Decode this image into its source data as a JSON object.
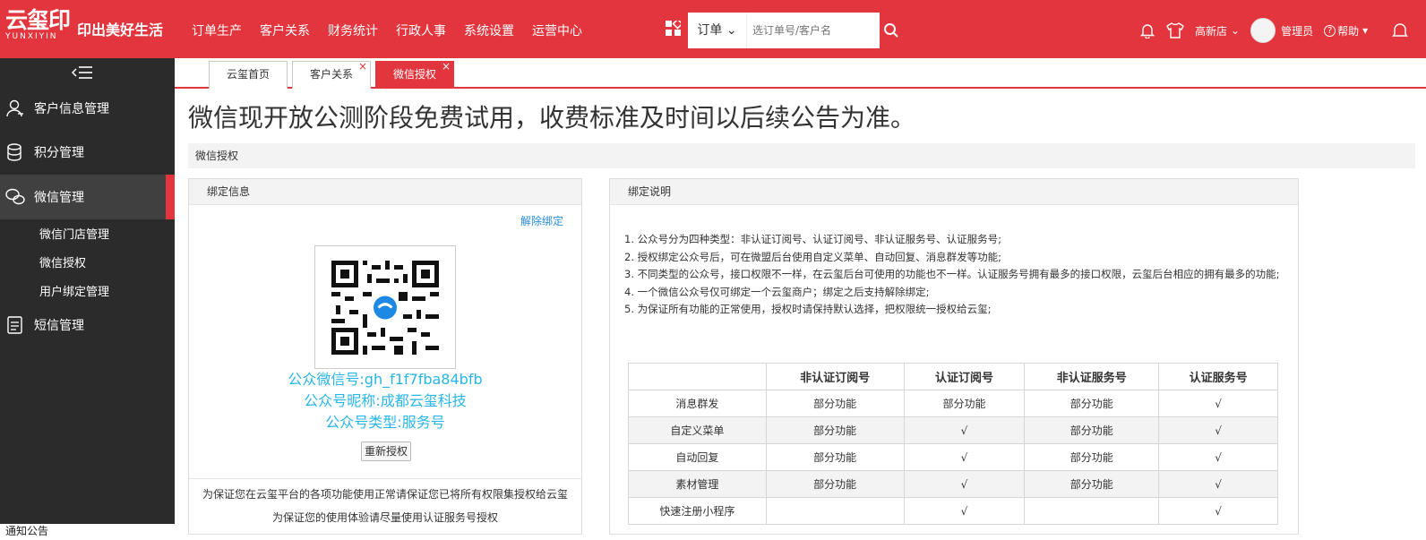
{
  "brand": {
    "logo_text": "云玺印",
    "logo_sub": "YUNXIYIN",
    "slogan": "印出美好生活",
    "accent": "#e3353e"
  },
  "topnav": [
    "订单生产",
    "客户关系",
    "财务统计",
    "行政人事",
    "系统设置",
    "运营中心"
  ],
  "search": {
    "select_label": "订单",
    "placeholder": "选订单号/客户名"
  },
  "user_tools": {
    "store": "高新店",
    "user": "管理员",
    "help": "帮助"
  },
  "sidebar": {
    "items": [
      {
        "label": "客户信息管理",
        "icon": "user-icon"
      },
      {
        "label": "积分管理",
        "icon": "database-icon"
      },
      {
        "label": "微信管理",
        "icon": "wechat-icon"
      }
    ],
    "sub_items": [
      "微信门店管理",
      "微信授权",
      "用户绑定管理"
    ],
    "item_sms": "短信管理",
    "bottom": "通知公告"
  },
  "tabs": [
    {
      "label": "云玺首页"
    },
    {
      "label": "客户关系"
    },
    {
      "label": "微信授权"
    }
  ],
  "headline": "微信现开放公测阶段免费试用，收费标准及时间以后续公告为准。",
  "section_title": "微信授权",
  "bind_info": {
    "title": "绑定信息",
    "unbind": "解除绑定",
    "account_id": "公众微信号:gh_f1f7fba84bfb",
    "nickname": "公众号昵称:成都云玺科技",
    "type": "公众号类型:服务号",
    "rebind": "重新授权",
    "foot1": "为保证您在云玺平台的各项功能使用正常请保证您已将所有权限集授权给云玺",
    "foot2": "为保证您的使用体验请尽量使用认证服务号授权"
  },
  "bind_desc": {
    "title": "绑定说明",
    "notes": [
      "1. 公众号分为四种类型：非认证订阅号、认证订阅号、非认证服务号、认证服务号;",
      "2. 授权绑定公众号后，可在微盟后台使用自定义菜单、自动回复、消息群发等功能;",
      "3. 不同类型的公众号，接口权限不一样，在云玺后台可使用的功能也不一样。认证服务号拥有最多的接口权限，云玺后台相应的拥有最多的功能;",
      "4. 一个微信公众号仅可绑定一个云玺商户；绑定之后支持解除绑定;",
      "5. 为保证所有功能的正常使用，授权时请保持默认选择，把权限统一授权给云玺;"
    ],
    "table": {
      "headers": [
        "",
        "非认证订阅号",
        "认证订阅号",
        "非认证服务号",
        "认证服务号"
      ],
      "rows": [
        [
          "消息群发",
          "部分功能",
          "部分功能",
          "部分功能",
          "√"
        ],
        [
          "自定义菜单",
          "部分功能",
          "√",
          "部分功能",
          "√"
        ],
        [
          "自动回复",
          "部分功能",
          "√",
          "部分功能",
          "√"
        ],
        [
          "素材管理",
          "部分功能",
          "√",
          "部分功能",
          "√"
        ],
        [
          "快速注册小程序",
          "",
          "√",
          "",
          "√"
        ]
      ]
    }
  }
}
